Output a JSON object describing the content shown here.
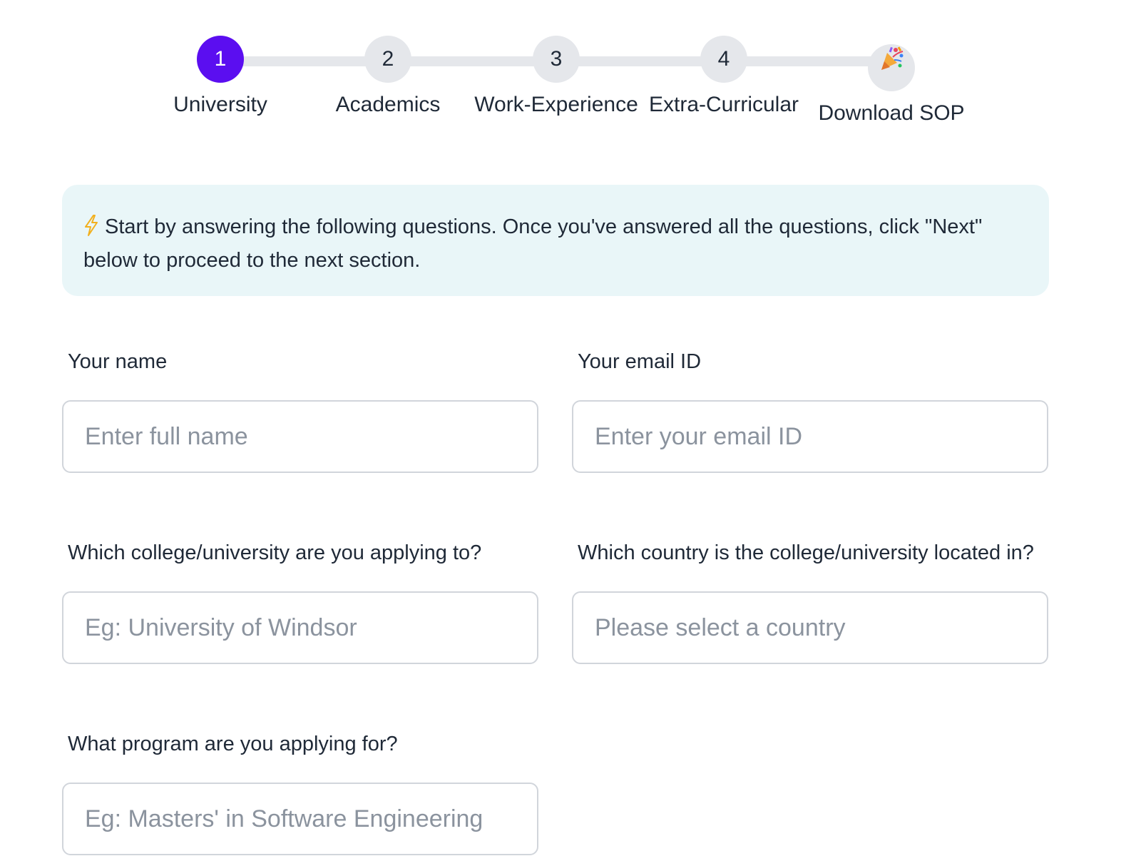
{
  "stepper": {
    "accent_color": "#5b0ef0",
    "active_step": 1,
    "steps": [
      {
        "number": "1",
        "label": "University"
      },
      {
        "number": "2",
        "label": "Academics"
      },
      {
        "number": "3",
        "label": "Work-Experience"
      },
      {
        "number": "4",
        "label": "Extra-Curricular"
      },
      {
        "icon": "party-popper-icon",
        "label": "Download SOP"
      }
    ]
  },
  "banner": {
    "icon": "lightning-bolt-icon",
    "text": "Start by answering the following questions. Once you've answered all the questions, click \"Next\" below to proceed to the next section."
  },
  "form": {
    "name": {
      "label": "Your name",
      "placeholder": "Enter full name"
    },
    "email": {
      "label": "Your email ID",
      "placeholder": "Enter your email ID"
    },
    "college": {
      "label": "Which college/university are you applying to?",
      "placeholder": "Eg: University of Windsor"
    },
    "country": {
      "label": "Which country is the college/university located in?",
      "placeholder": "Please select a country"
    },
    "program": {
      "label": "What program are you applying for?",
      "placeholder": "Eg: Masters' in Software Engineering"
    }
  }
}
